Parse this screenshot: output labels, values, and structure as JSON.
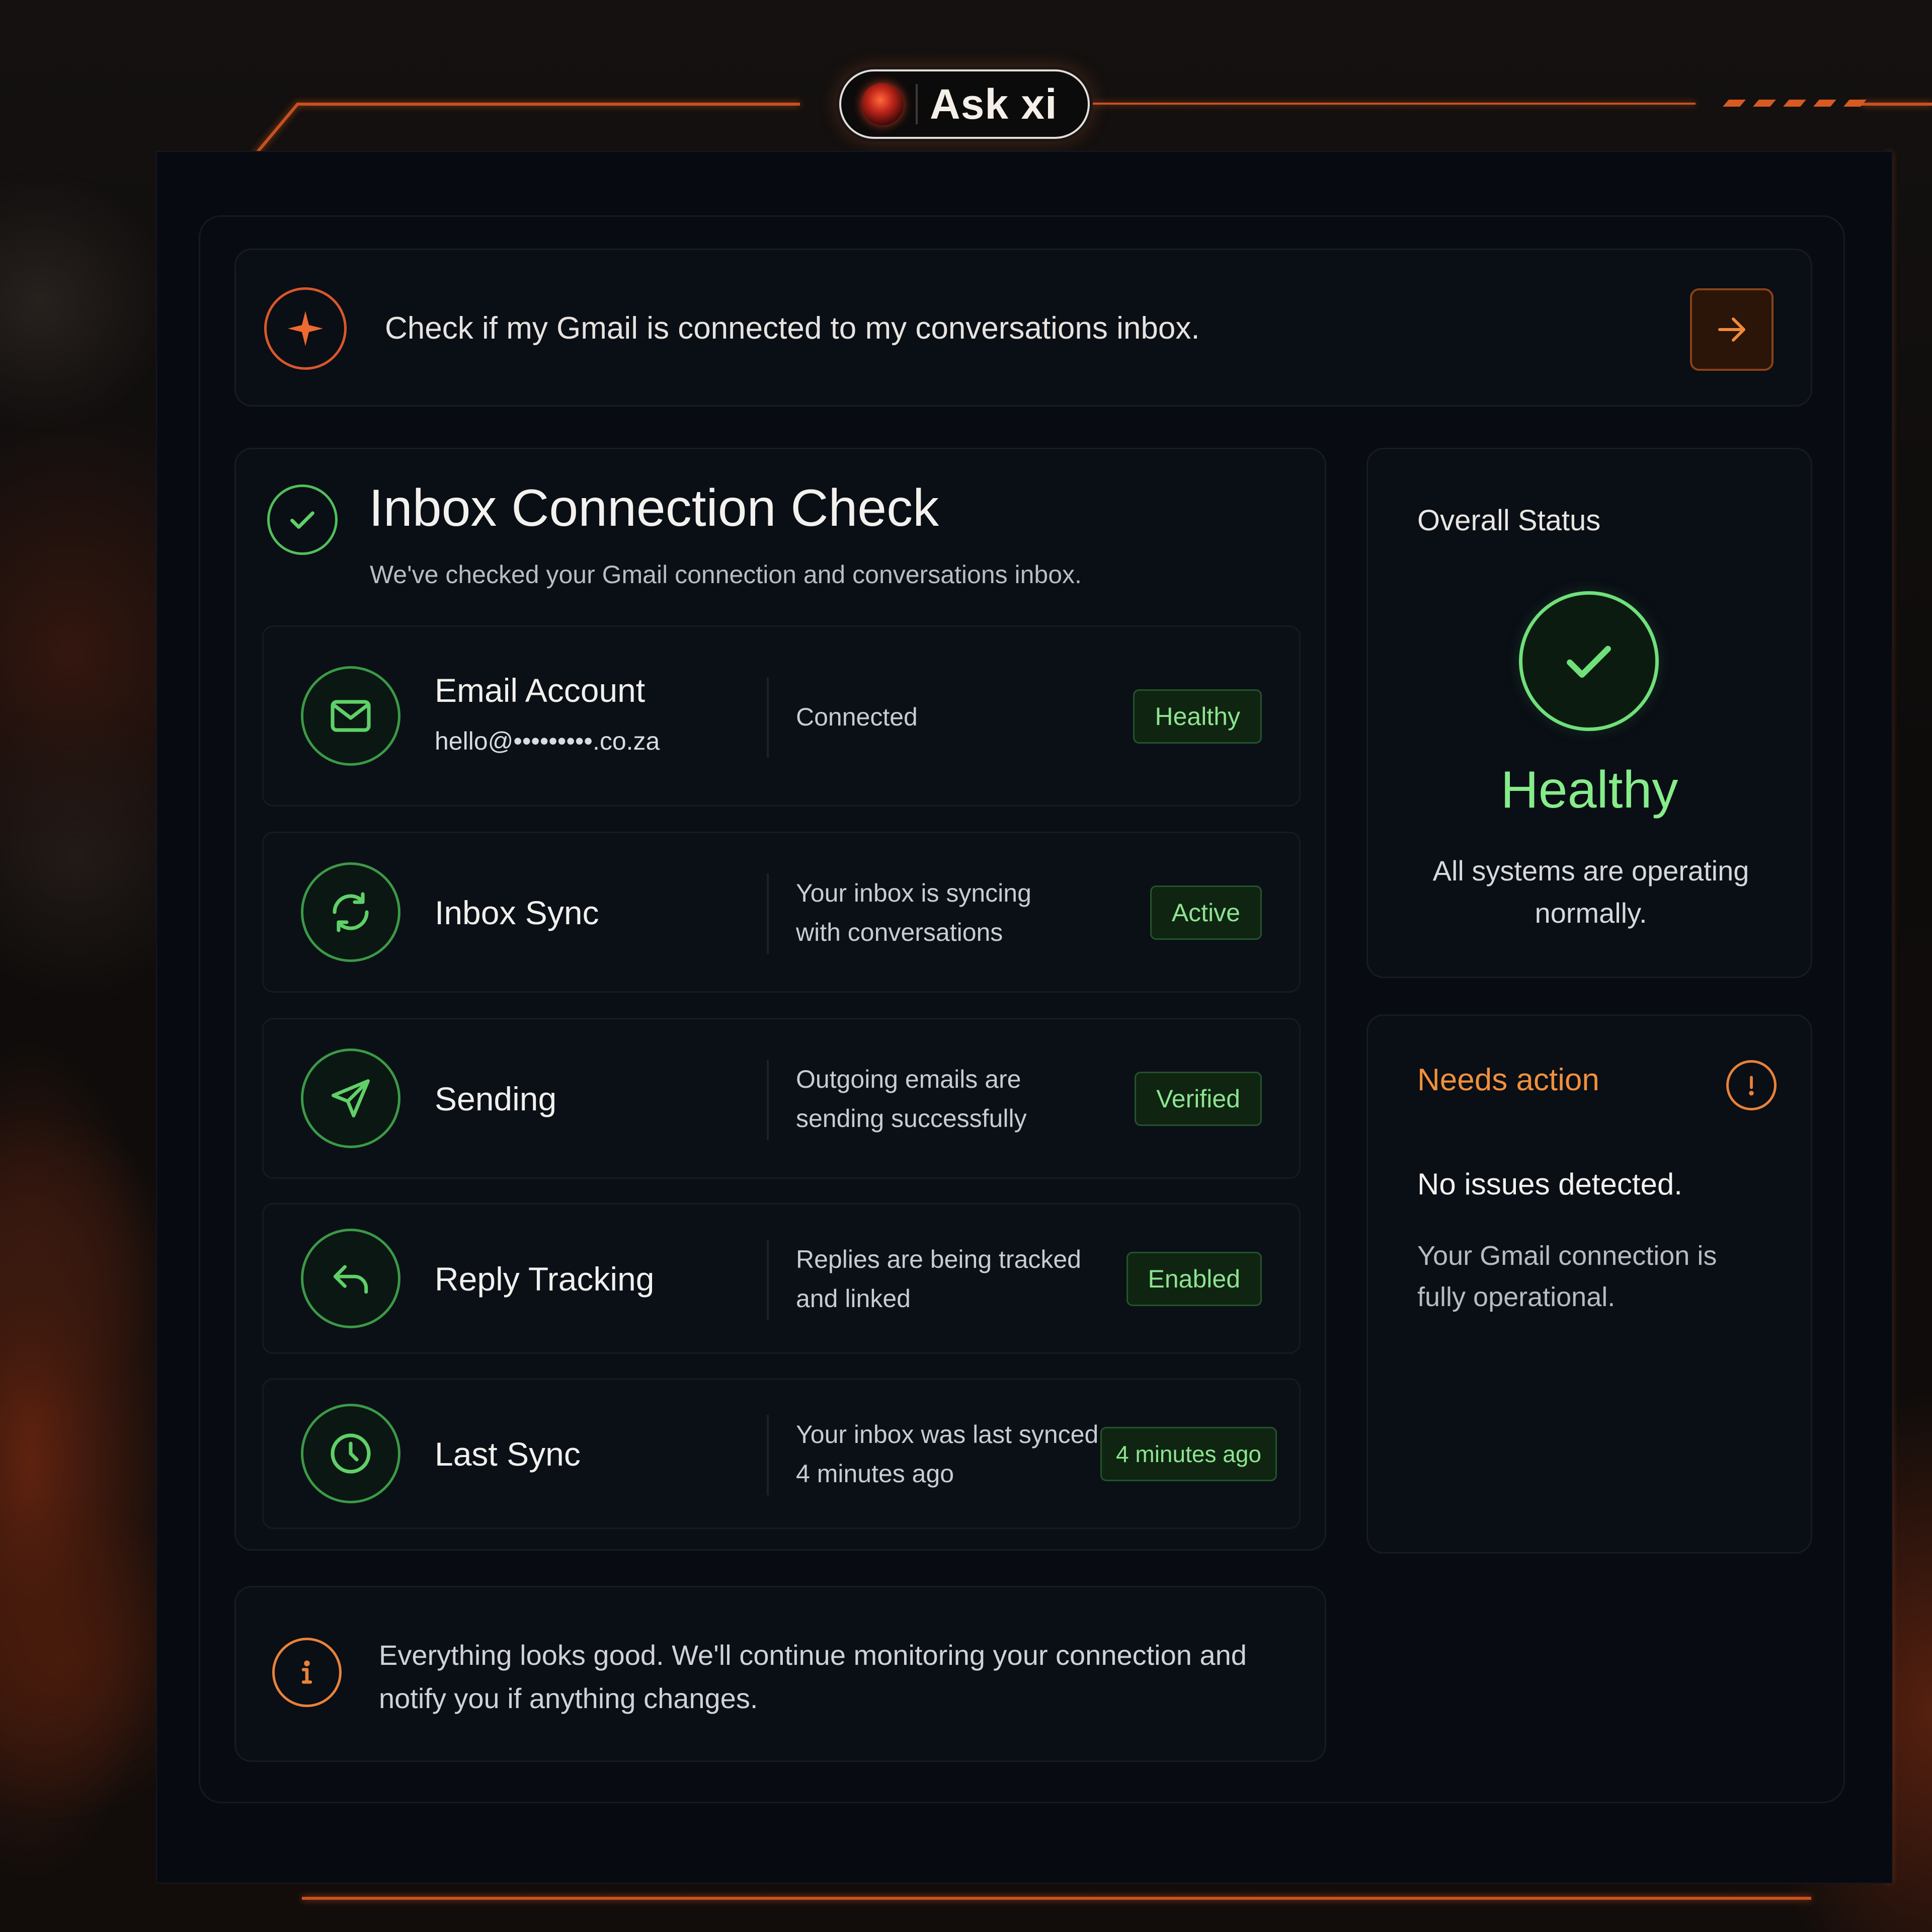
{
  "app": {
    "title": "Ask xi"
  },
  "prompt": {
    "text": "Check if my Gmail is connected to my conversations inbox."
  },
  "check": {
    "title": "Inbox Connection Check",
    "subtitle": "We've checked your Gmail connection and conversations inbox.",
    "rows": [
      {
        "title": "Email Account",
        "subtitle": "hello@•••••••••.co.za",
        "desc": [
          "Connected"
        ],
        "badge": "Healthy",
        "icon": "mail-icon"
      },
      {
        "title": "Inbox Sync",
        "desc": [
          "Your inbox is syncing",
          "with conversations"
        ],
        "badge": "Active",
        "icon": "sync-icon"
      },
      {
        "title": "Sending",
        "desc": [
          "Outgoing emails are",
          "sending successfully"
        ],
        "badge": "Verified",
        "icon": "send-icon"
      },
      {
        "title": "Reply Tracking",
        "desc": [
          "Replies are being tracked",
          "and linked"
        ],
        "badge": "Enabled",
        "icon": "reply-icon"
      },
      {
        "title": "Last Sync",
        "desc": [
          "Your inbox was last synced",
          "4 minutes ago"
        ],
        "badge": "4 minutes ago",
        "icon": "clock-icon"
      }
    ]
  },
  "status": {
    "label": "Overall Status",
    "value": "Healthy",
    "desc": "All systems are operating normally."
  },
  "action": {
    "label": "Needs action",
    "title": "No issues detected.",
    "desc": "Your Gmail connection is fully operational."
  },
  "info": {
    "text": "Everything looks good. We'll continue monitoring your connection and notify you if anything changes."
  },
  "colors": {
    "accent_orange": "#d8582a",
    "status_green": "#86ec8a",
    "background": "#070a10"
  }
}
